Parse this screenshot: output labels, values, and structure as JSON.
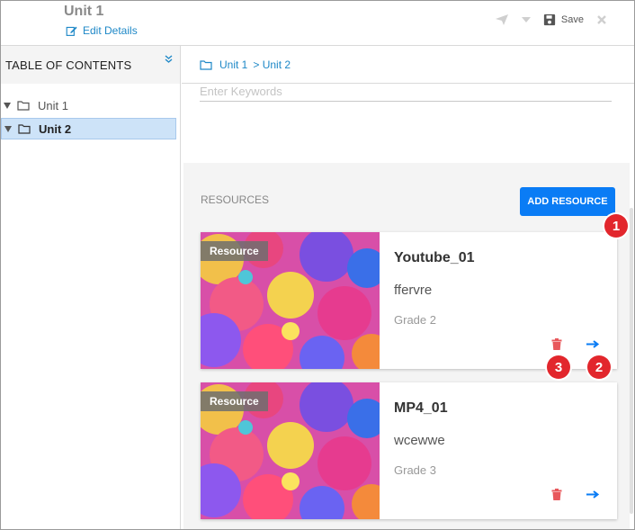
{
  "header": {
    "title": "Unit 1",
    "edit_label": "Edit Details",
    "save_label": "Save"
  },
  "sidebar": {
    "toc_title": "TABLE OF CONTENTS",
    "items": [
      {
        "label": "Unit 1",
        "active": false
      },
      {
        "label": "Unit 2",
        "active": true
      }
    ]
  },
  "breadcrumb": {
    "items": [
      "Unit 1",
      "> Unit 2"
    ]
  },
  "search": {
    "placeholder": "Enter Keywords"
  },
  "resources": {
    "title": "RESOURCES",
    "add_label": "ADD RESOURCE",
    "cards": [
      {
        "tag": "Resource",
        "name": "Youtube_01",
        "desc": "ffervre",
        "grade": "Grade 2"
      },
      {
        "tag": "Resource",
        "name": "MP4_01",
        "desc": "wcewwe",
        "grade": "Grade 3"
      }
    ]
  },
  "annotations": {
    "badge1": "1",
    "badge2": "2",
    "badge3": "3"
  },
  "colors": {
    "accent": "#0a7cf5",
    "link": "#1e88c7",
    "delete": "#e8585c",
    "badge": "#e2262c",
    "active_bg": "#cde3f8"
  }
}
